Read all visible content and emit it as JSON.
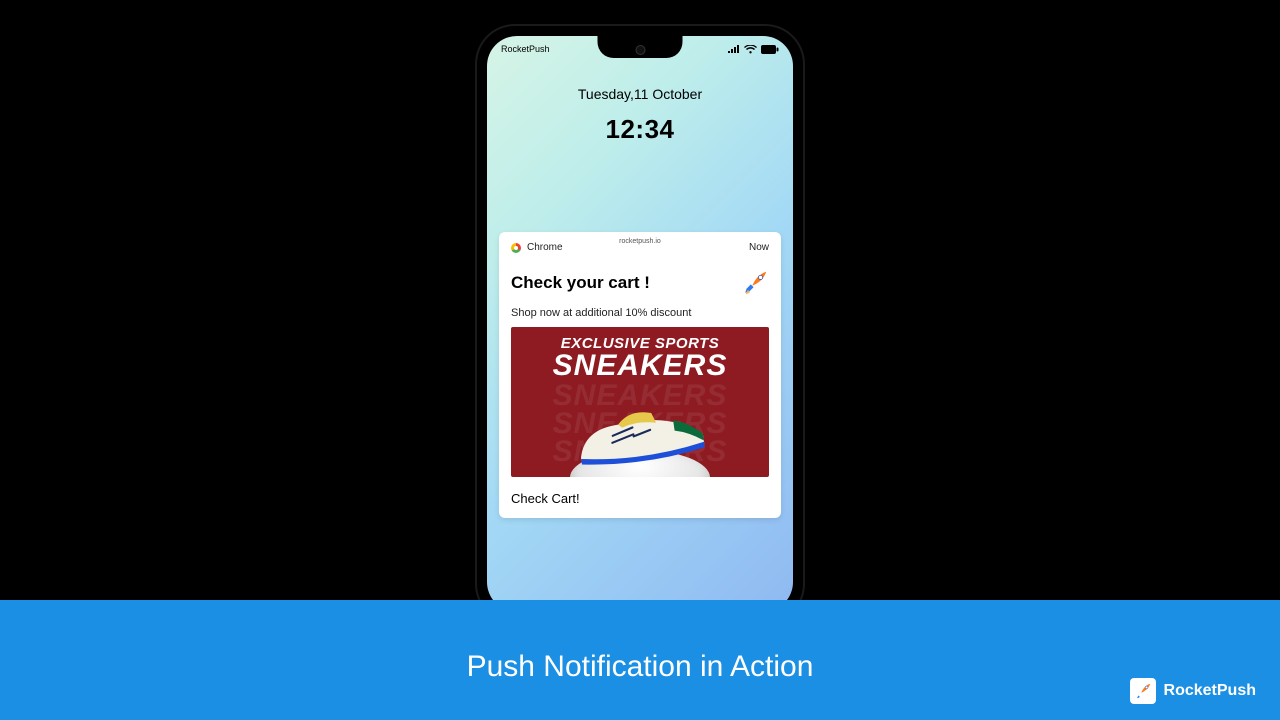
{
  "statusbar": {
    "carrier": "RocketPush"
  },
  "lockscreen": {
    "date": "Tuesday,11 October",
    "time": "12:34"
  },
  "notification": {
    "app": "Chrome",
    "domain": "rocketpush.io",
    "when": "Now",
    "title": "Check your cart !",
    "body": "Shop now at additional 10% discount",
    "banner_line1": "EXCLUSIVE SPORTS",
    "banner_line2": "SNEAKERS",
    "banner_ghost": "SNEAKERS",
    "cta": "Check Cart!"
  },
  "footer": {
    "title": "Push Notification in Action",
    "brand": "RocketPush"
  }
}
